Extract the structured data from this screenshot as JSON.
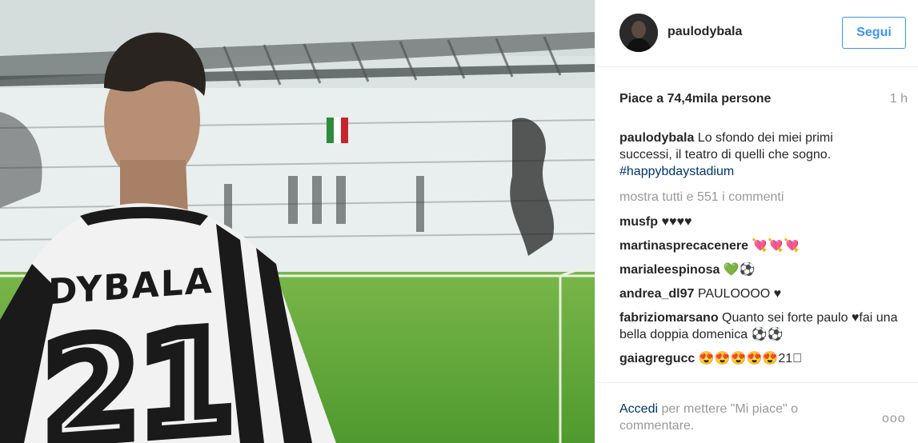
{
  "photo": {
    "jersey_name": "DYBALA",
    "jersey_number": "21"
  },
  "header": {
    "username": "paulodybala",
    "follow_label": "Segui"
  },
  "meta": {
    "likes": "Piace a 74,4mila persone",
    "time": "1 h"
  },
  "caption": {
    "username": "paulodybala",
    "text": " Lo sfondo dei miei primi successi, il teatro di quelli che sogno. ",
    "hashtag": "#happybdaystadium"
  },
  "show_all": "mostra tutti e 551 i commenti",
  "comments": [
    {
      "user": "musfp",
      "text": " ♥♥♥♥"
    },
    {
      "user": "martinasprecacenere",
      "text": " 💘💘💘"
    },
    {
      "user": "marialeespinosa",
      "text": " 💚⚽"
    },
    {
      "user": "andrea_dl97",
      "text": " PAULOOOO ♥"
    },
    {
      "user": "fabriziomarsano",
      "text": " Quanto sei forte paulo ♥fai una bella doppia domenica ⚽⚽"
    },
    {
      "user": "gaiagregucc",
      "text": " 😍😍😍😍😍21⃣"
    }
  ],
  "footer": {
    "login_link": "Accedi",
    "login_rest": " per mettere \"Mi piace\" o commentare.",
    "more_icon": "ooo"
  }
}
